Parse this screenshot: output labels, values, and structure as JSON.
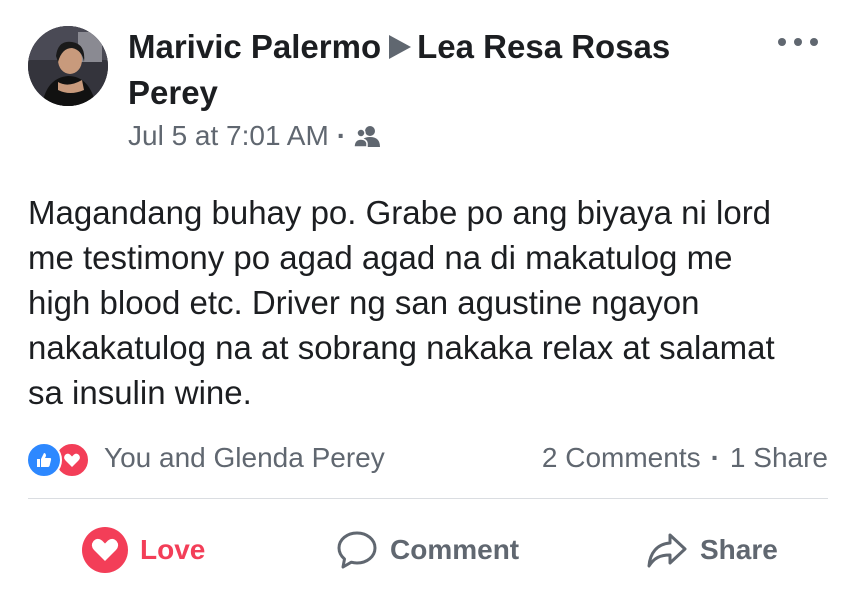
{
  "post": {
    "author": "Marivic Palermo",
    "recipient_line1": "Lea Resa Rosas",
    "recipient_line2": "Perey",
    "timestamp": "Jul 5 at 7:01 AM",
    "privacy_icon": "friends-icon",
    "text_lines": [
      "Magandang buhay po. Grabe po ang biyaya ni lord",
      "me testimony po agad agad na di makatulog me",
      "high blood etc. Driver ng san agustine ngayon",
      "nakakatulog na at sobrang nakaka relax at salamat",
      "sa insulin wine."
    ]
  },
  "reactions": {
    "icons": [
      "like-icon",
      "love-icon"
    ],
    "summary": "You and Glenda Perey"
  },
  "counts": {
    "comments": "2 Comments",
    "shares": "1 Share"
  },
  "actions": {
    "love_label": "Love",
    "comment_label": "Comment",
    "share_label": "Share"
  },
  "colors": {
    "love": "#f33e58",
    "like": "#2d88ff",
    "secondary_text": "#606770",
    "primary_text": "#1c1e21"
  }
}
